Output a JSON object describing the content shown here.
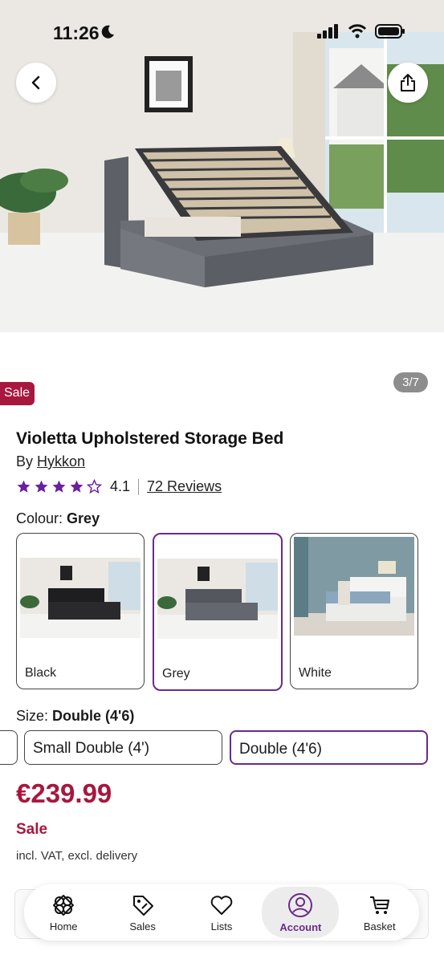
{
  "status_bar": {
    "time": "11:26"
  },
  "gallery": {
    "counter": "3/7"
  },
  "badge": {
    "sale": "Sale"
  },
  "product": {
    "title": "Violetta Upholstered Storage Bed",
    "by_prefix": "By",
    "brand": "Hykkon",
    "rating": "4.1",
    "rating_stars": 4,
    "reviews": "72 Reviews"
  },
  "colour": {
    "label": "Colour:",
    "selected": "Grey",
    "options": [
      {
        "label": "Black"
      },
      {
        "label": "Grey"
      },
      {
        "label": "White"
      }
    ]
  },
  "size": {
    "label": "Size:",
    "selected": "Double (4'6)",
    "options": [
      {
        "label": "Small Double (4')"
      },
      {
        "label": "Double (4'6)"
      }
    ]
  },
  "pricing": {
    "price": "€239.99",
    "sale_text": "Sale",
    "vat_note": "incl. VAT, excl. delivery"
  },
  "nav": {
    "items": [
      {
        "label": "Home"
      },
      {
        "label": "Sales"
      },
      {
        "label": "Lists"
      },
      {
        "label": "Account"
      },
      {
        "label": "Basket"
      }
    ]
  },
  "colors": {
    "accent": "#6a2a8a",
    "sale": "#a8173e",
    "star": "#6a1fa0"
  }
}
